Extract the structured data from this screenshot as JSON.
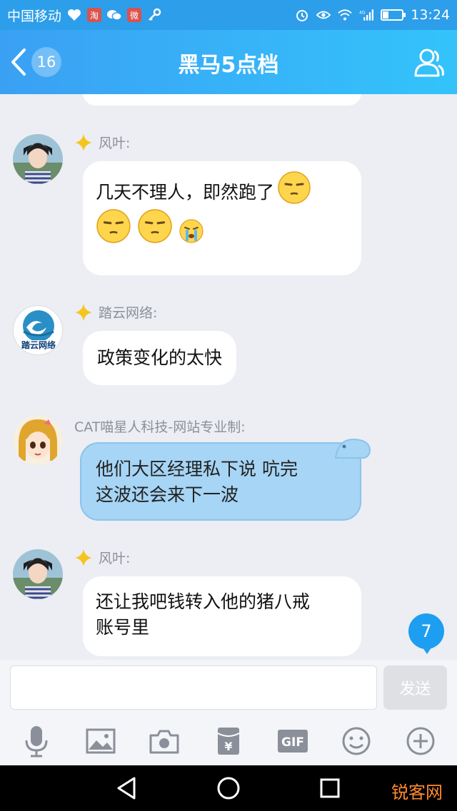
{
  "status_bar": {
    "carrier": "中国移动",
    "notif_badge_1": "淘",
    "notif_badge_2": "微",
    "time": "13:24",
    "network": "4G"
  },
  "header": {
    "unread_count": "16",
    "title": "黑马5点档"
  },
  "messages": [
    {
      "sender": "风叶:",
      "text": "几天不理人，即然跑了"
    },
    {
      "sender": "踏云网络:",
      "text": "政策变化的太快",
      "avatar_text": "踏云网络"
    },
    {
      "sender": "CAT喵星人科技-网站专业制:",
      "line1": "他们大区经理私下说  吭完",
      "line2": "这波还会来下一波"
    },
    {
      "sender": "风叶:",
      "line1": "还让我吧钱转入他的猪八戒",
      "line2": "账号里"
    }
  ],
  "new_msg_badge": "7",
  "input": {
    "value": "",
    "send_label": "发送"
  },
  "tools": [
    "mic-icon",
    "image-icon",
    "camera-icon",
    "red-packet-icon",
    "gif-icon",
    "emoji-icon",
    "plus-icon"
  ],
  "tool_labels": {
    "gif": "GIF",
    "red_packet": "¥"
  },
  "watermark": "锐客网",
  "colors": {
    "header_start": "#3aa0f3",
    "header_end": "#33c3fa",
    "bubble_blue": "#a6d5f5",
    "badge": "#1e9ef0"
  }
}
